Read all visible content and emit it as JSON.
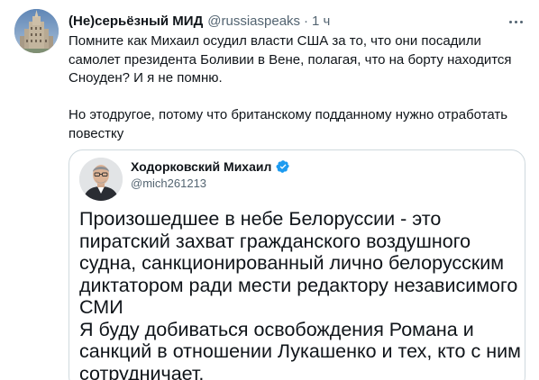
{
  "tweet": {
    "author_name": "(Не)серьёзный МИД",
    "author_handle": "@russiaspeaks",
    "separator": "·",
    "time": "1 ч",
    "paragraph_1": "Помните как Михаил осудил власти США за то, что они посадили самолет президента Боливии в Вене, полагая, что на борту находится Сноуден? И я не помню.",
    "paragraph_2": "Но этодругое, потому что британскому подданному нужно отработать повестку",
    "icons": {
      "avatar": "building-avatar-icon",
      "more": "more-options-icon"
    }
  },
  "quoted_tweet": {
    "author_name": "Ходорковский Михаил",
    "author_handle": "@mich261213",
    "text_paragraph_1": "Произошедшее в небе Белоруссии  - это пиратский захват гражданского воздушного судна, санкционированный  лично белорусским диктатором ради мести редактору независимого СМИ",
    "text_paragraph_2": "Я буду добиваться освобождения Романа и санкций в отношении Лукашенко и тех, кто с ним сотрудничает.",
    "icons": {
      "avatar": "person-avatar-icon",
      "verified": "verified-badge-icon"
    }
  },
  "colors": {
    "text_primary": "#0f1419",
    "text_secondary": "#536471",
    "border": "#cfd9de",
    "verified": "#1d9bf0"
  }
}
